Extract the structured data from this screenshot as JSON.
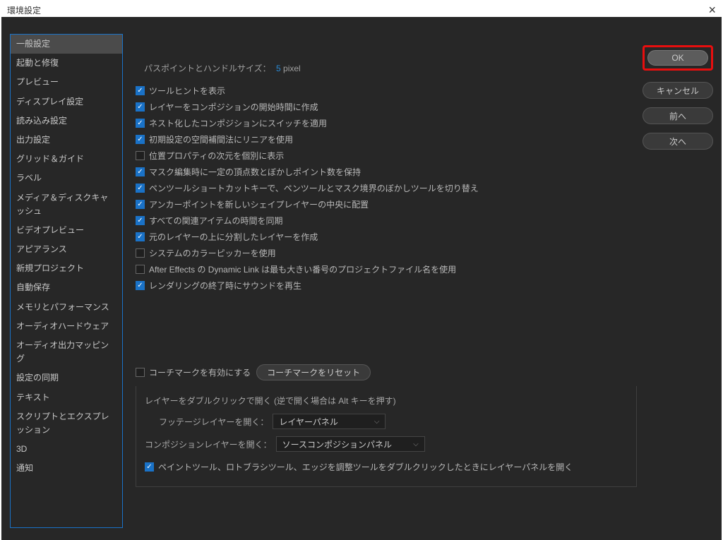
{
  "window": {
    "title": "環境設定"
  },
  "sidebar": {
    "items": [
      "一般設定",
      "起動と修復",
      "プレビュー",
      "ディスプレイ設定",
      "読み込み設定",
      "出力設定",
      "グリッド＆ガイド",
      "ラベル",
      "メディア＆ディスクキャッシュ",
      "ビデオプレビュー",
      "アピアランス",
      "新規プロジェクト",
      "自動保存",
      "メモリとパフォーマンス",
      "オーディオハードウェア",
      "オーディオ出力マッピング",
      "設定の同期",
      "テキスト",
      "スクリプトとエクスプレッション",
      "3D",
      "通知"
    ],
    "selectedIndex": 0
  },
  "buttons": {
    "ok": "OK",
    "cancel": "キャンセル",
    "prev": "前へ",
    "next": "次へ"
  },
  "top": {
    "label": "パスポイントとハンドルサイズ：",
    "value": "5",
    "unit": "pixel"
  },
  "checks": [
    {
      "label": "ツールヒントを表示",
      "checked": true
    },
    {
      "label": "レイヤーをコンポジションの開始時間に作成",
      "checked": true
    },
    {
      "label": "ネスト化したコンポジションにスイッチを適用",
      "checked": true
    },
    {
      "label": "初期設定の空間補間法にリニアを使用",
      "checked": true
    },
    {
      "label": "位置プロパティの次元を個別に表示",
      "checked": false
    },
    {
      "label": "マスク編集時に一定の頂点数とぼかしポイント数を保持",
      "checked": true
    },
    {
      "label": "ペンツールショートカットキーで、ペンツールとマスク境界のぼかしツールを切り替え",
      "checked": true
    },
    {
      "label": "アンカーポイントを新しいシェイプレイヤーの中央に配置",
      "checked": true
    },
    {
      "label": "すべての関連アイテムの時間を同期",
      "checked": true
    },
    {
      "label": "元のレイヤーの上に分割したレイヤーを作成",
      "checked": true
    },
    {
      "label": "システムのカラーピッカーを使用",
      "checked": false
    },
    {
      "label": "After Effects の Dynamic Link は最も大きい番号のプロジェクトファイル名を使用",
      "checked": false
    },
    {
      "label": "レンダリングの終了時にサウンドを再生",
      "checked": true
    }
  ],
  "coach": {
    "check": {
      "label": "コーチマークを有効にする",
      "checked": false
    },
    "reset": "コーチマークをリセット"
  },
  "doubleclick": {
    "title": "レイヤーをダブルクリックで開く (逆で開く場合は Alt キーを押す)",
    "footage": {
      "label": "フッテージレイヤーを開く：",
      "value": "レイヤーパネル"
    },
    "comp": {
      "label": "コンポジションレイヤーを開く：",
      "value": "ソースコンポジションパネル"
    },
    "paint": {
      "label": "ペイントツール、ロトブラシツール、エッジを調整ツールをダブルクリックしたときにレイヤーパネルを開く",
      "checked": true
    }
  }
}
